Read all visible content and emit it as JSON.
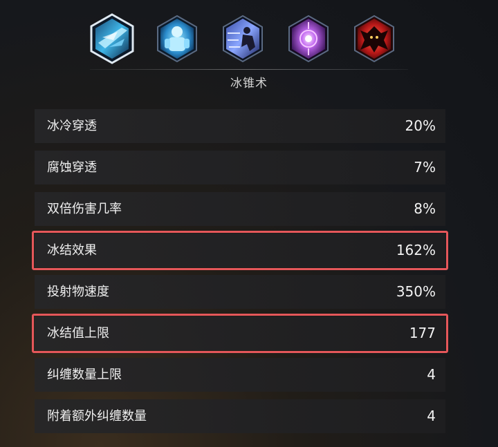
{
  "skill_name": "冰锥术",
  "skills": [
    {
      "icon": "ice-shard-icon",
      "selected": true,
      "color": "#3fb6e8"
    },
    {
      "icon": "ice-golem-icon",
      "selected": false,
      "color": "#55c6f0"
    },
    {
      "icon": "dash-figure-icon",
      "selected": false,
      "color": "#6a7fd8"
    },
    {
      "icon": "arcane-orb-icon",
      "selected": false,
      "color": "#b055e6"
    },
    {
      "icon": "demon-icon",
      "selected": false,
      "color": "#d83030"
    }
  ],
  "stats": [
    {
      "label": "冰冷穿透",
      "value": "20%",
      "highlighted": false
    },
    {
      "label": "腐蚀穿透",
      "value": "7%",
      "highlighted": false
    },
    {
      "label": "双倍伤害几率",
      "value": "8%",
      "highlighted": false
    },
    {
      "label": "冰结效果",
      "value": "162%",
      "highlighted": true
    },
    {
      "label": "投射物速度",
      "value": "350%",
      "highlighted": false
    },
    {
      "label": "冰结值上限",
      "value": "177",
      "highlighted": true
    },
    {
      "label": "纠缠数量上限",
      "value": "4",
      "highlighted": false
    },
    {
      "label": "附着额外纠缠数量",
      "value": "4",
      "highlighted": false
    }
  ],
  "colors": {
    "highlight_border": "#e5575a",
    "row_background": "#262628"
  }
}
